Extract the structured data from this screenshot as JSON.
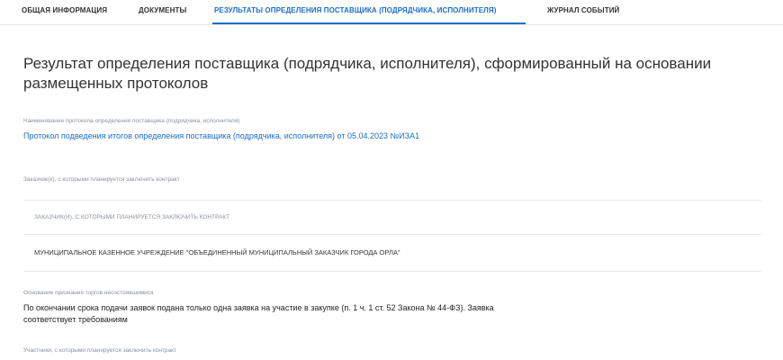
{
  "tabs": [
    {
      "label": "ОБЩАЯ ИНФОРМАЦИЯ",
      "active": false
    },
    {
      "label": "ДОКУМЕНТЫ",
      "active": false
    },
    {
      "label": "РЕЗУЛЬТАТЫ ОПРЕДЕЛЕНИЯ ПОСТАВЩИКА (ПОДРЯДЧИКА, ИСПОЛНИТЕЛЯ)",
      "active": true
    },
    {
      "label": "ЖУРНАЛ СОБЫТИЙ",
      "active": false
    }
  ],
  "page": {
    "title": "Результат определения поставщика (подрядчика, исполнителя), сформированный на основании размещенных протоколов"
  },
  "protocol": {
    "label": "Наименование протокола определения поставщика (подрядчика, исполнителя)",
    "link": "Протокол подведения итогов определения поставщика (подрядчика, исполнителя) от 05.04.2023 №ИЗА1"
  },
  "customers": {
    "label": "Заказчик(и), с которыми планируется заключить контракт",
    "table_header": "ЗАКАЗЧИК(И), С КОТОРЫМИ ПЛАНИРУЕТСЯ ЗАКЛЮЧИТЬ КОНТРАКТ",
    "rows": [
      "МУНИЦИПАЛЬНОЕ КАЗЕННОЕ УЧРЕЖДЕНИЕ \"ОБЪЕДИНЕННЫЙ МУНИЦИПАЛЬНЫЙ ЗАКАЗЧИК ГОРОДА ОРЛА\""
    ]
  },
  "basis": {
    "label": "Основание признания торгов несостоявшимися",
    "text": "По окончании срока подачи заявок подана только одна заявка на участие в закупке (п. 1 ч. 1 ст. 52 Закона № 44-ФЗ). Заявка соответствует требованиям"
  },
  "participants": {
    "label": "Участники, с которыми планируется заключить контракт"
  },
  "colors": {
    "accent": "#1a6fc4",
    "muted": "#8a929c",
    "divider": "#e5e8eb"
  }
}
